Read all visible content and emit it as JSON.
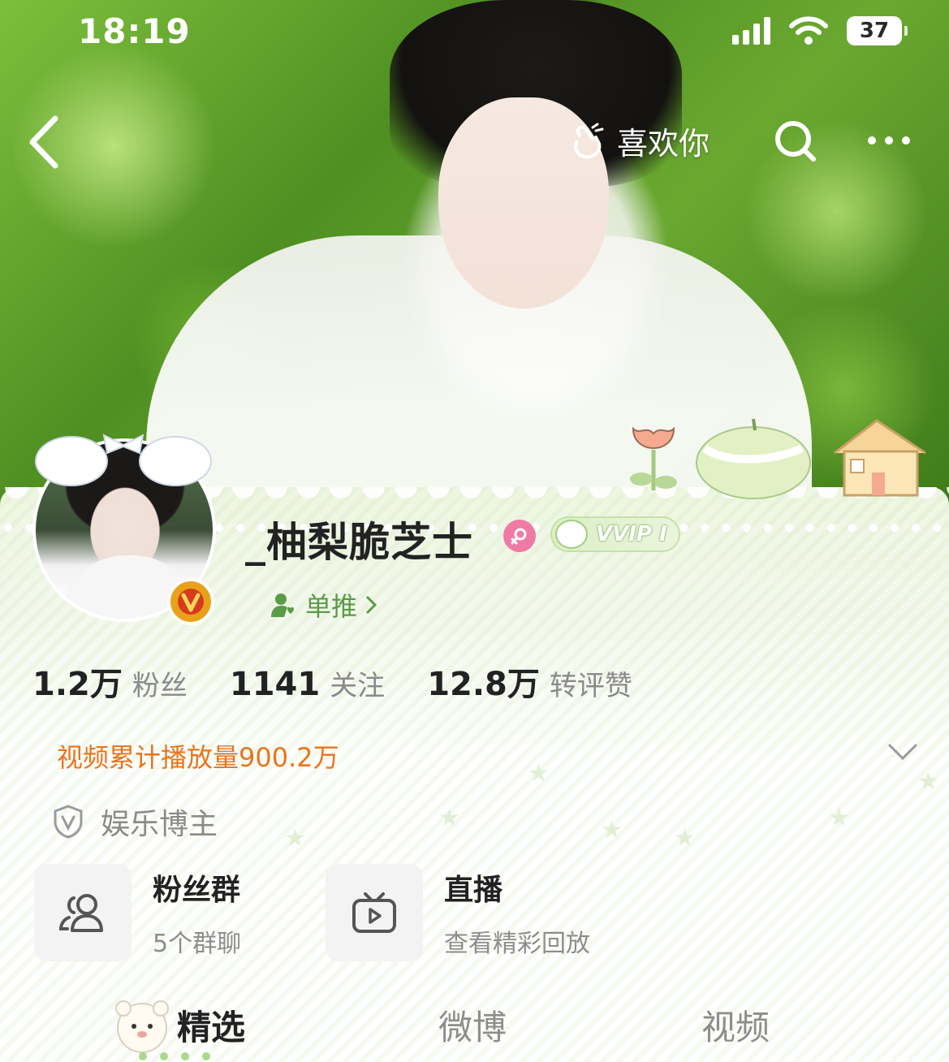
{
  "status_bar": {
    "time": "18:19",
    "battery": "37"
  },
  "nav": {
    "like_you_label": "喜欢你"
  },
  "profile": {
    "username": "_柚梨脆芝士",
    "vip_label": "VVIP I",
    "single_push_label": "单推"
  },
  "stats": [
    {
      "value": "1.2万",
      "label": "粉丝"
    },
    {
      "value": "1141",
      "label": "关注"
    },
    {
      "value": "12.8万",
      "label": "转评赞"
    }
  ],
  "video_plays": "视频累计播放量900.2万",
  "category": "娱乐博主",
  "tiles": [
    {
      "title": "粉丝群",
      "subtitle": "5个群聊"
    },
    {
      "title": "直播",
      "subtitle": "查看精彩回放"
    }
  ],
  "tabs": [
    {
      "label": "精选",
      "active": true
    },
    {
      "label": "微博",
      "active": false
    },
    {
      "label": "视频",
      "active": false
    }
  ],
  "colors": {
    "accent_orange": "#e9741b",
    "accent_green": "#5a9b48",
    "verified_gold": "#e8a21a",
    "gender_pink": "#ef7ba4"
  }
}
